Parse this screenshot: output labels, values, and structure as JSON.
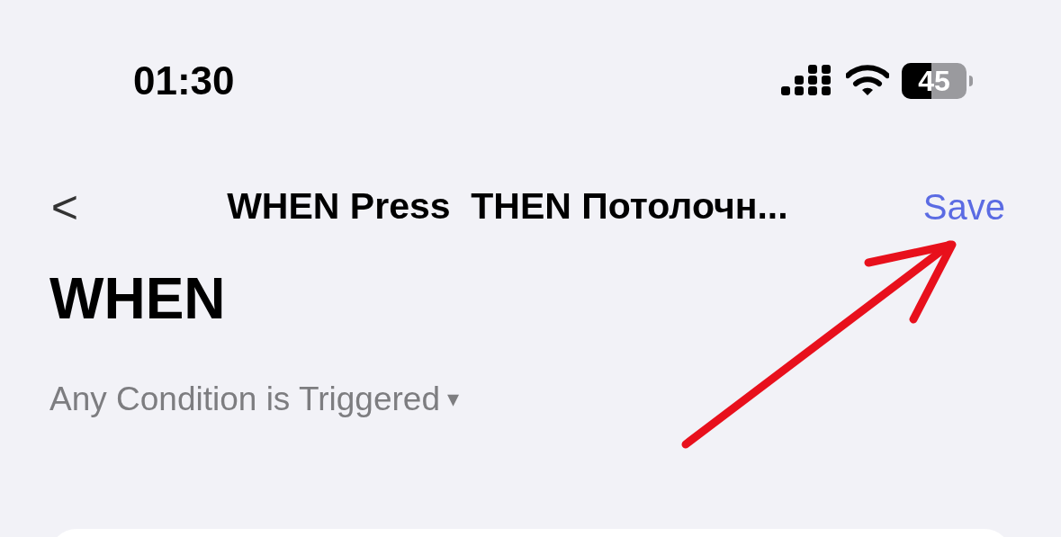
{
  "status_bar": {
    "time": "01:30",
    "battery": "45"
  },
  "nav": {
    "back": "<",
    "title": "WHEN Press  THEN Потолочн...",
    "action": "Save"
  },
  "section": {
    "title": "WHEN",
    "condition": "Any Condition is Triggered",
    "dropdown": "▾"
  },
  "annotation": {
    "kind": "arrow"
  }
}
